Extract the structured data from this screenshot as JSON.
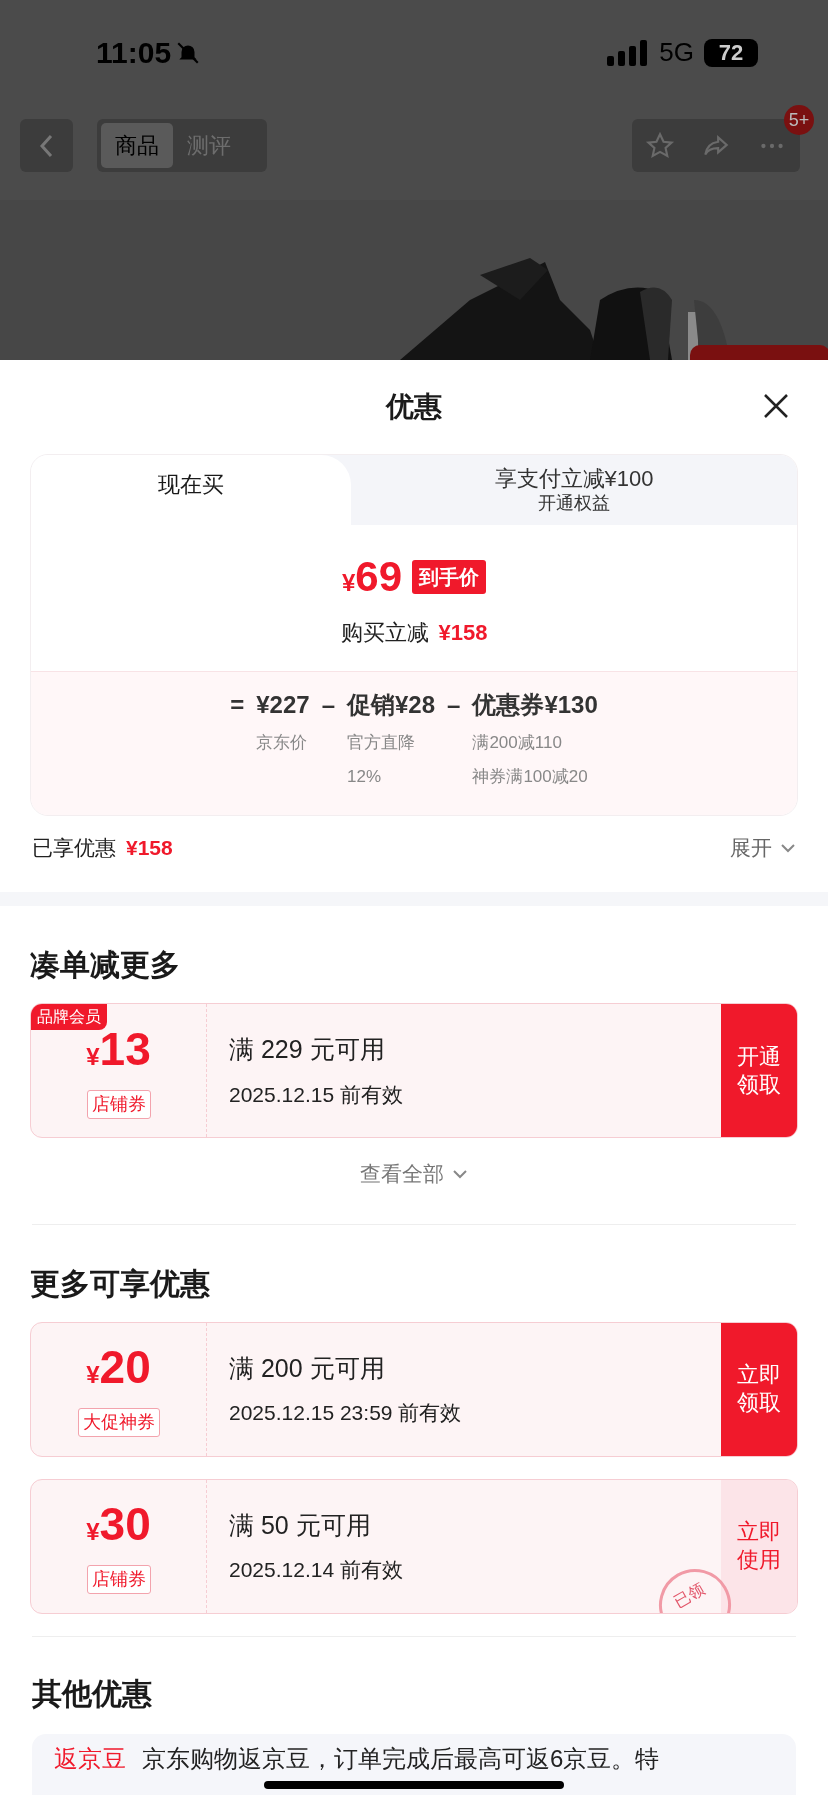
{
  "status_bar": {
    "time": "11:05",
    "network": "5G",
    "battery": "72"
  },
  "nav": {
    "tabs": [
      {
        "label": "商品",
        "selected": true
      },
      {
        "label": "测评",
        "selected": false
      }
    ],
    "badge": "5+"
  },
  "sheet": {
    "title": "优惠",
    "modes": [
      {
        "label": "现在买",
        "selected": true
      },
      {
        "label": "享支付立减¥100",
        "sublabel": "开通权益",
        "selected": false
      }
    ],
    "price": {
      "currency": "¥",
      "amount": "69",
      "tag": "到手价",
      "saving_label": "购买立减",
      "saving": "¥158"
    },
    "formula": [
      {
        "op": "=",
        "value": "¥227",
        "notes": [
          "京东价"
        ]
      },
      {
        "op": "–",
        "value": "促销¥28",
        "notes": [
          "官方直降",
          "12%"
        ]
      },
      {
        "op": "–",
        "value": "优惠券¥130",
        "notes": [
          "满200减110",
          "神券满100减20"
        ]
      }
    ],
    "enjoyed": {
      "label": "已享优惠",
      "amount": "¥158",
      "expand": "展开"
    }
  },
  "sections": [
    {
      "title": "凑单减更多",
      "more": "查看全部",
      "coupons": [
        {
          "corner_tag": "品牌会员",
          "currency": "¥",
          "amount": "13",
          "type": "店铺券",
          "condition": "满 229 元可用",
          "validity": "2025.12.15 前有效",
          "action": "开通领取",
          "claimed": false
        }
      ]
    },
    {
      "title": "更多可享优惠",
      "coupons": [
        {
          "currency": "¥",
          "amount": "20",
          "type": "大促神券",
          "condition": "满 200 元可用",
          "validity": "2025.12.15 23:59 前有效",
          "action": "立即领取",
          "claimed": false
        },
        {
          "currency": "¥",
          "amount": "30",
          "type": "店铺券",
          "condition": "满 50 元可用",
          "validity": "2025.12.14 前有效",
          "action": "立即使用",
          "claimed": true,
          "stamp": "已领"
        }
      ]
    }
  ],
  "other": {
    "title": "其他优惠",
    "items": [
      {
        "tag": "返京豆",
        "text": "京东购物返京豆，订单完成后最高可返6京豆。特"
      }
    ]
  }
}
